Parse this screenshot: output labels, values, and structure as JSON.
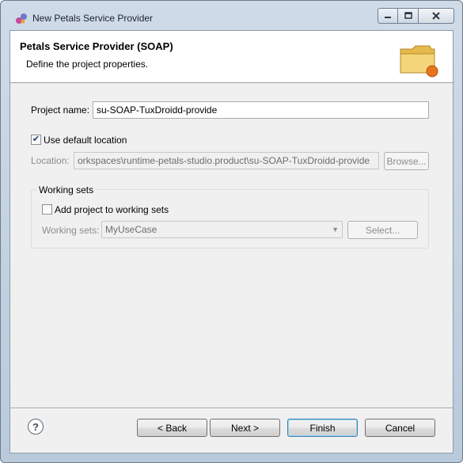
{
  "window": {
    "title": "New Petals Service Provider",
    "controls": {
      "minimize": "0",
      "maximize": "1",
      "close": "r"
    }
  },
  "banner": {
    "title": "Petals Service Provider (SOAP)",
    "description": "Define the project properties.",
    "icon": "folder-icon"
  },
  "form": {
    "project_name_label": "Project name:",
    "project_name_value": "su-SOAP-TuxDroidd-provide",
    "use_default_location_label": "Use default location",
    "use_default_location_checked": true,
    "location_label": "Location:",
    "location_value": "orkspaces\\runtime-petals-studio.product\\su-SOAP-TuxDroidd-provide",
    "browse_label": "Browse..."
  },
  "working_sets": {
    "group_label": "Working sets",
    "add_label": "Add project to working sets",
    "add_checked": false,
    "sets_label": "Working sets:",
    "sets_value": "MyUseCase",
    "select_label": "Select..."
  },
  "footer": {
    "help_icon": "?",
    "back_label": "< Back",
    "next_label": "Next >",
    "finish_label": "Finish",
    "cancel_label": "Cancel"
  }
}
